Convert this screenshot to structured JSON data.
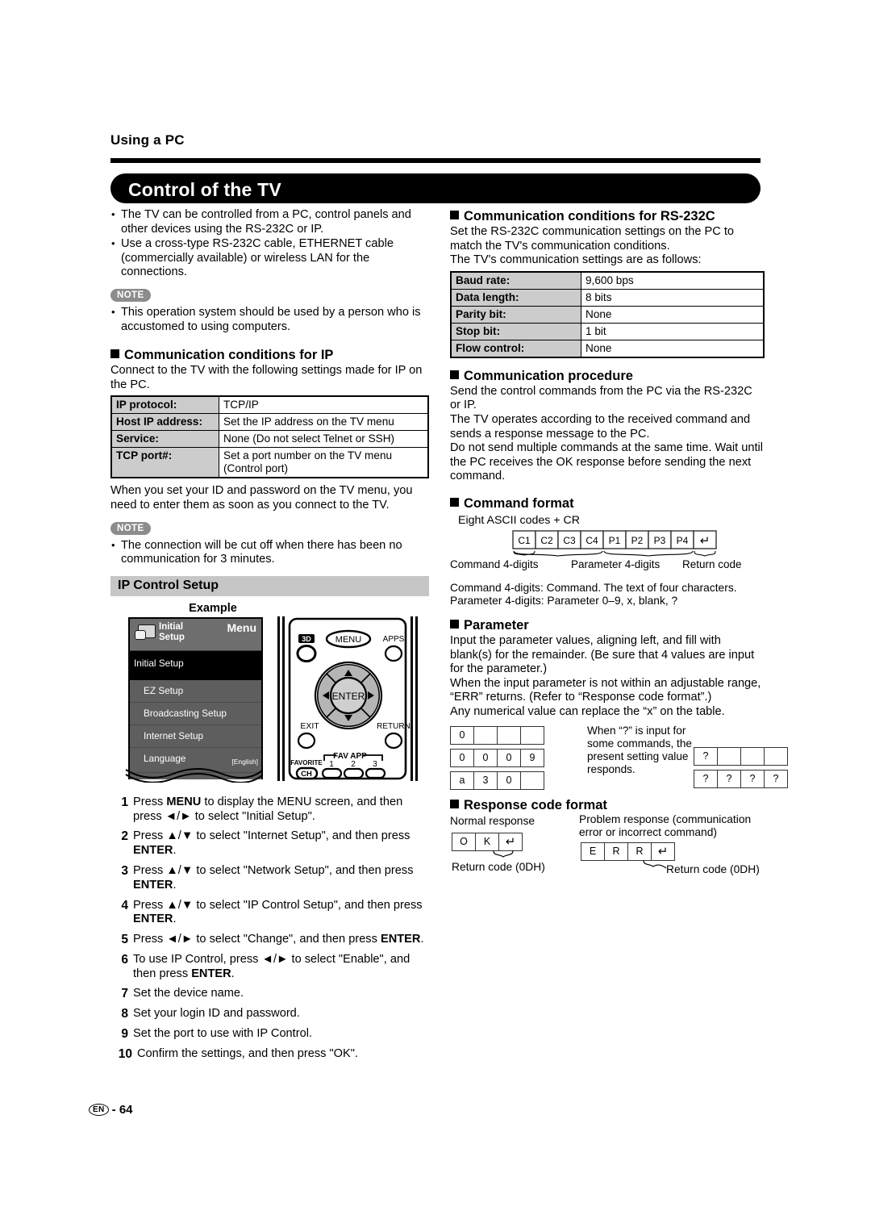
{
  "page": {
    "running_head": "Using a PC",
    "title": "Control of the TV",
    "footer_lang": "EN",
    "footer_sep": "-",
    "footer_page": "64"
  },
  "left": {
    "intro_bullets": [
      "The TV can be controlled from a PC, control panels and other devices using the RS-232C or IP.",
      "Use a cross-type RS-232C cable, ETHERNET cable (commercially available) or wireless LAN for the connections."
    ],
    "note1": {
      "badge": "NOTE",
      "items": [
        "This operation system should be used by a person who is accustomed to using computers."
      ]
    },
    "ip_section": {
      "heading": "Communication conditions for IP",
      "intro": "Connect to the TV with the following settings made for IP on the PC.",
      "table": [
        {
          "key": "IP protocol:",
          "value": "TCP/IP"
        },
        {
          "key": "Host IP address:",
          "value": "Set the IP address on the TV menu"
        },
        {
          "key": "Service:",
          "value": "None (Do not select Telnet or SSH)"
        },
        {
          "key": "TCP port#:",
          "value": "Set a port number on the TV menu (Control port)"
        }
      ],
      "after_table": "When you set your ID and password on the TV menu, you need to enter them as soon as you connect to the TV."
    },
    "note2": {
      "badge": "NOTE",
      "items": [
        "The connection will be cut off when there has been no communication for 3 minutes."
      ]
    },
    "ip_control_setup": {
      "band_title": "IP Control Setup",
      "example_label": "Example",
      "tv_menu": {
        "header_title_line1": "Initial",
        "header_title_line2": "Setup",
        "menu_word": "Menu",
        "selected_item": "Initial Setup",
        "items": [
          {
            "label": "EZ Setup",
            "value": ""
          },
          {
            "label": "Broadcasting Setup",
            "value": ""
          },
          {
            "label": "Internet Setup",
            "value": ""
          },
          {
            "label": "Language",
            "value": "[English]"
          }
        ]
      },
      "remote": {
        "btn_3d": "3D",
        "btn_menu": "MENU",
        "btn_apps": "APPS",
        "btn_enter": "ENTER",
        "btn_exit": "EXIT",
        "btn_return": "RETURN",
        "fav_app_label": "FAV APP",
        "fav_buttons": [
          "1",
          "2",
          "3"
        ],
        "favorite_label": "FAVORITE",
        "favorite_ch": "CH"
      }
    },
    "steps": [
      {
        "n": "1",
        "text": "Press MENU to display the MENU screen, and then press ◄/► to select \"Initial Setup\"."
      },
      {
        "n": "2",
        "text": "Press ▲/▼ to select \"Internet Setup\", and then press ENTER."
      },
      {
        "n": "3",
        "text": "Press ▲/▼ to select \"Network Setup\", and then press ENTER."
      },
      {
        "n": "4",
        "text": "Press ▲/▼ to select \"IP Control Setup\", and then press ENTER."
      },
      {
        "n": "5",
        "text": "Press ◄/► to select \"Change\", and then press ENTER."
      },
      {
        "n": "6",
        "text": "To use IP Control, press ◄/► to select \"Enable\", and then press ENTER."
      },
      {
        "n": "7",
        "text": "Set the device name."
      },
      {
        "n": "8",
        "text": "Set your login ID and password."
      },
      {
        "n": "9",
        "text": "Set the port to use with IP Control."
      },
      {
        "n": "10",
        "text": "Confirm the settings, and then press \"OK\"."
      }
    ]
  },
  "right": {
    "rs232c": {
      "heading": "Communication conditions for RS-232C",
      "intro_line1": "Set the RS-232C communication settings on the PC to match the TV's communication conditions.",
      "intro_line2": "The TV's communication settings are as follows:",
      "table": [
        {
          "key": "Baud rate:",
          "value": "9,600 bps"
        },
        {
          "key": "Data length:",
          "value": "8 bits"
        },
        {
          "key": "Parity bit:",
          "value": "None"
        },
        {
          "key": "Stop bit:",
          "value": "1 bit"
        },
        {
          "key": "Flow control:",
          "value": "None"
        }
      ]
    },
    "procedure": {
      "heading": "Communication procedure",
      "paragraphs": [
        "Send the control commands from the PC via the RS-232C or IP.",
        "The TV operates according to the received command and sends a response message to the PC.",
        "Do not send multiple commands at the same time. Wait until the PC receives the OK response before sending the next command."
      ]
    },
    "command_format": {
      "heading": "Command format",
      "subtitle": "Eight ASCII codes + CR",
      "cells": [
        "C1",
        "C2",
        "C3",
        "C4",
        "P1",
        "P2",
        "P3",
        "P4",
        "↵"
      ],
      "brace_labels": [
        "Command 4-digits",
        "Parameter 4-digits",
        "Return code"
      ],
      "notes": [
        "Command 4-digits: Command. The text of four characters.",
        "Parameter 4-digits: Parameter 0–9, x, blank, ?"
      ]
    },
    "parameter": {
      "heading": "Parameter",
      "paragraphs": [
        "Input the parameter values, aligning left, and fill with blank(s) for the remainder. (Be sure that 4 values are input for the parameter.)",
        "When the input parameter is not within an adjustable range, “ERR” returns. (Refer to “Response code format”.)",
        "Any numerical value can replace the “x” on the table."
      ],
      "examples_left": [
        [
          "0",
          "",
          "",
          ""
        ],
        [
          "0",
          "0",
          "0",
          "9"
        ],
        [
          "a",
          "3",
          "0",
          ""
        ]
      ],
      "question_text": "When “?” is input for some commands, the present setting value responds.",
      "examples_right": [
        [
          "?",
          "",
          "",
          ""
        ],
        [
          "?",
          "?",
          "?",
          "?"
        ]
      ]
    },
    "response_code": {
      "heading": "Response code format",
      "normal_label": "Normal response",
      "normal_cells": [
        "O",
        "K",
        "↵"
      ],
      "normal_caption": "Return code (0DH)",
      "problem_label": "Problem response (communication error or incorrect command)",
      "problem_cells": [
        "E",
        "R",
        "R",
        "↵"
      ],
      "problem_caption": "Return code (0DH)"
    }
  }
}
